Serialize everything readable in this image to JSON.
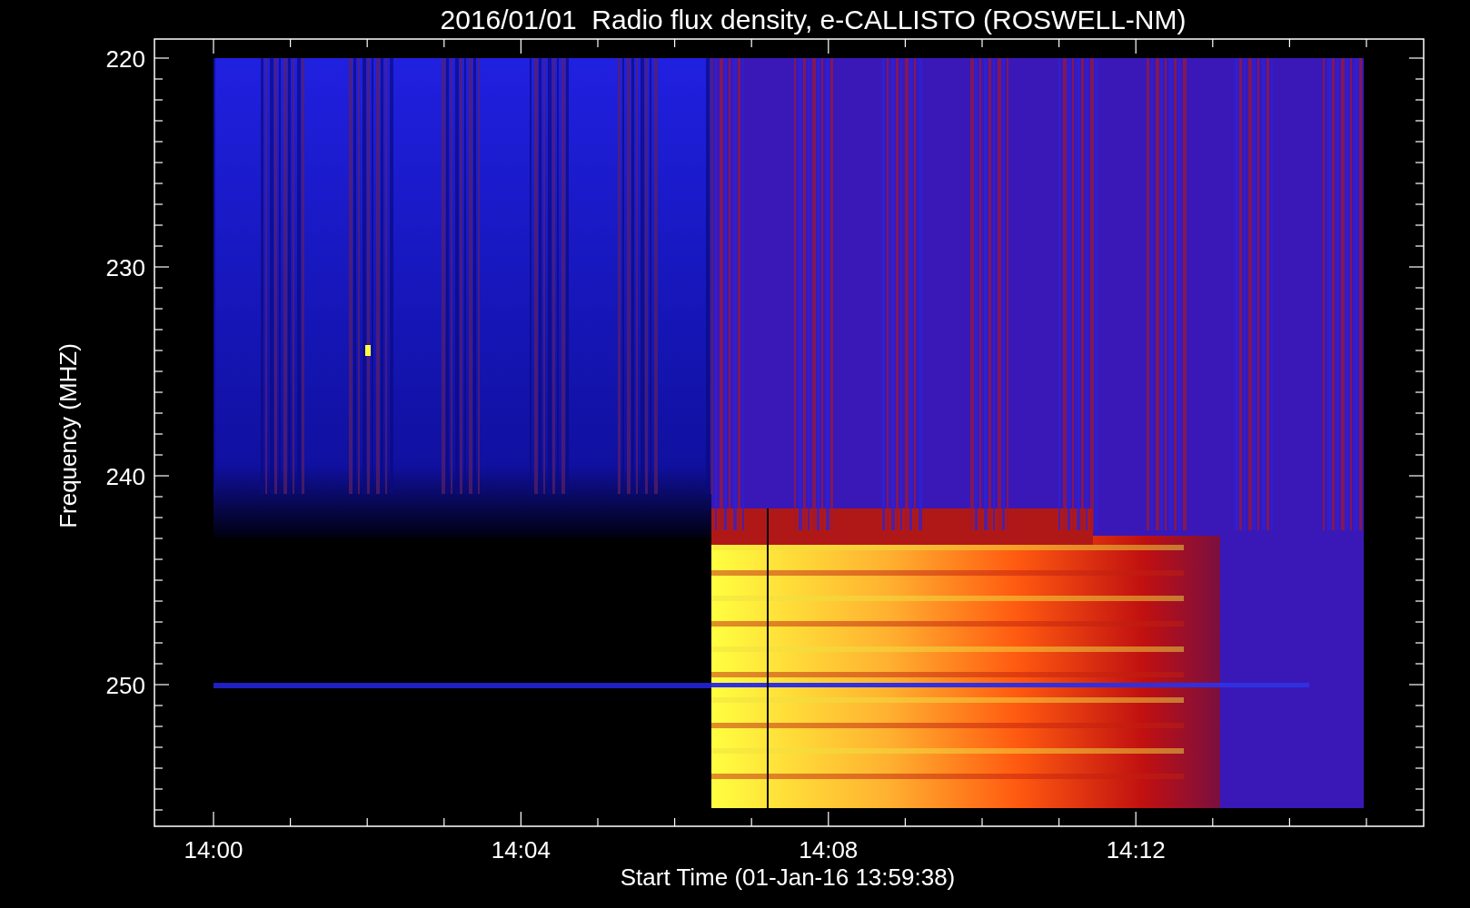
{
  "title": "2016/01/01  Radio flux density, e-CALLISTO (ROSWELL-NM)",
  "y_axis": {
    "label": "Frequency (MHZ)",
    "ticks": [
      "220",
      "230",
      "240",
      "250"
    ]
  },
  "x_axis": {
    "label": "Start Time (01-Jan-16 13:59:38)",
    "ticks": [
      "14:00",
      "14:04",
      "14:08",
      "14:12"
    ]
  }
}
